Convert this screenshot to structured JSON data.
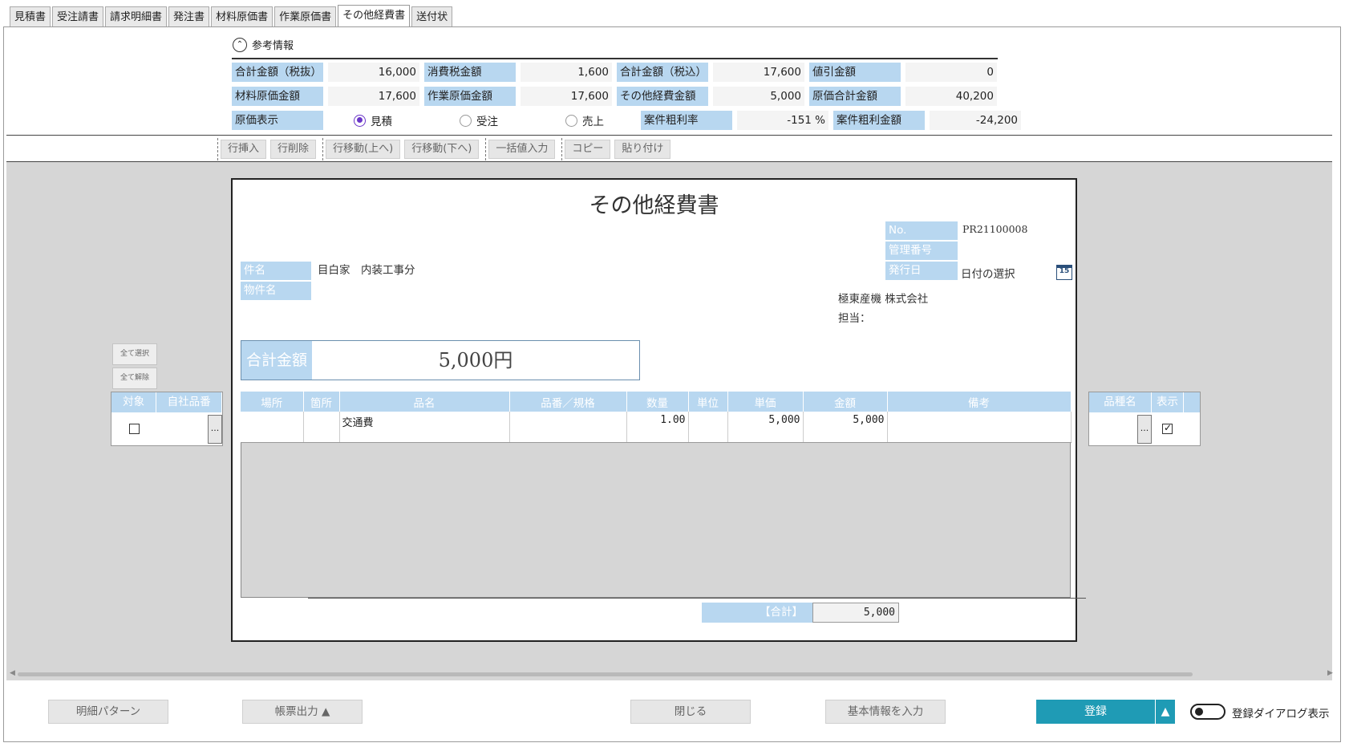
{
  "tabs": [
    "見積書",
    "受注請書",
    "請求明細書",
    "発注書",
    "材料原価書",
    "作業原価書",
    "その他経費書",
    "送付状"
  ],
  "active_tab": "その他経費書",
  "ref": {
    "title": "参考情報",
    "subtotal_label": "合計金額（税抜）",
    "subtotal": "16,000",
    "tax_label": "消費税金額",
    "tax": "1,600",
    "total_incl_label": "合計金額（税込）",
    "total_incl": "17,600",
    "discount_label": "値引金額",
    "discount": "0",
    "material_label": "材料原価金額",
    "material": "17,600",
    "work_label": "作業原価金額",
    "work": "17,600",
    "other_label": "その他経費金額",
    "other": "5,000",
    "cost_total_label": "原価合計金額",
    "cost_total": "40,200",
    "cost_display_label": "原価表示",
    "radio_estimate": "見積",
    "radio_order": "受注",
    "radio_sales": "売上",
    "margin_rate_label": "案件粗利率",
    "margin_rate": "-151 %",
    "margin_amount_label": "案件粗利金額",
    "margin_amount": "-24,200"
  },
  "toolbar": {
    "insert": "行挿入",
    "delete": "行削除",
    "move_up": "行移動(上へ)",
    "move_down": "行移動(下へ)",
    "bulk": "一括値入力",
    "copy": "コピー",
    "paste": "貼り付け"
  },
  "doc": {
    "title": "その他経費書",
    "no_label": "No.",
    "no": "PR21100008",
    "mgmt_label": "管理番号",
    "mgmt": "",
    "issue_label": "発行日",
    "issue": "日付の選択",
    "calendar_day": "15",
    "subject_label": "件名",
    "subject": "目白家　内装工事分",
    "property_label": "物件名",
    "property": "",
    "company": "極東産機 株式会社",
    "staff": "担当：",
    "total_label": "合計金額",
    "total": "5,000円",
    "sum_label": "【合計】",
    "sum": "5,000"
  },
  "table": {
    "headers": [
      "場所",
      "箇所",
      "品名",
      "品番／規格",
      "数量",
      "単位",
      "単価",
      "金額",
      "備考"
    ],
    "rows": [
      [
        "",
        "",
        "交通費",
        "",
        "1.00",
        "",
        "5,000",
        "5,000",
        ""
      ]
    ]
  },
  "side": {
    "select_all": "全て選択",
    "deselect_all": "全て解除",
    "left_headers": [
      "対象",
      "自社品番"
    ],
    "right_headers": [
      "品種名",
      "表示"
    ],
    "ellipsis": "..."
  },
  "bottom": {
    "pattern": "明細パターン",
    "output": "帳票出力 ▲",
    "close": "閉じる",
    "basic": "基本情報を入力",
    "register": "登録",
    "register_arrow": "▲",
    "dialog_toggle": "登録ダイアログ表示"
  }
}
